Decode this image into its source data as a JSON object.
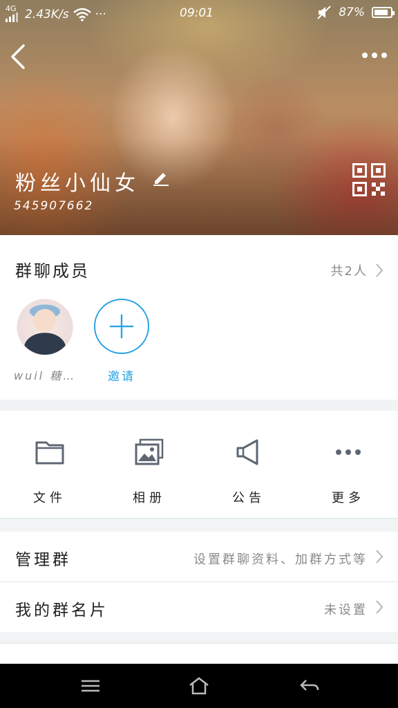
{
  "status_bar": {
    "network": "4G",
    "speed": "2.43K/s",
    "more": "···",
    "time": "09:01",
    "battery": "87%",
    "battery_level": 0.87
  },
  "header": {
    "group_name": "粉丝小仙女",
    "group_id": "545907662"
  },
  "members": {
    "title": "群聊成员",
    "count": "共2人",
    "list": [
      {
        "name": "wuil 糖…"
      }
    ],
    "invite_label": "邀请"
  },
  "actions": [
    {
      "label": "文件",
      "icon": "folder-icon"
    },
    {
      "label": "相册",
      "icon": "album-icon"
    },
    {
      "label": "公告",
      "icon": "megaphone-icon"
    },
    {
      "label": "更多",
      "icon": "more-dots-icon"
    }
  ],
  "rows": [
    {
      "title": "管理群",
      "value": "设置群聊资料、加群方式等"
    },
    {
      "title": "我的群名片",
      "value": "未设置"
    }
  ],
  "colors": {
    "accent": "#27a3e3",
    "icon_gray": "#5d6672"
  }
}
